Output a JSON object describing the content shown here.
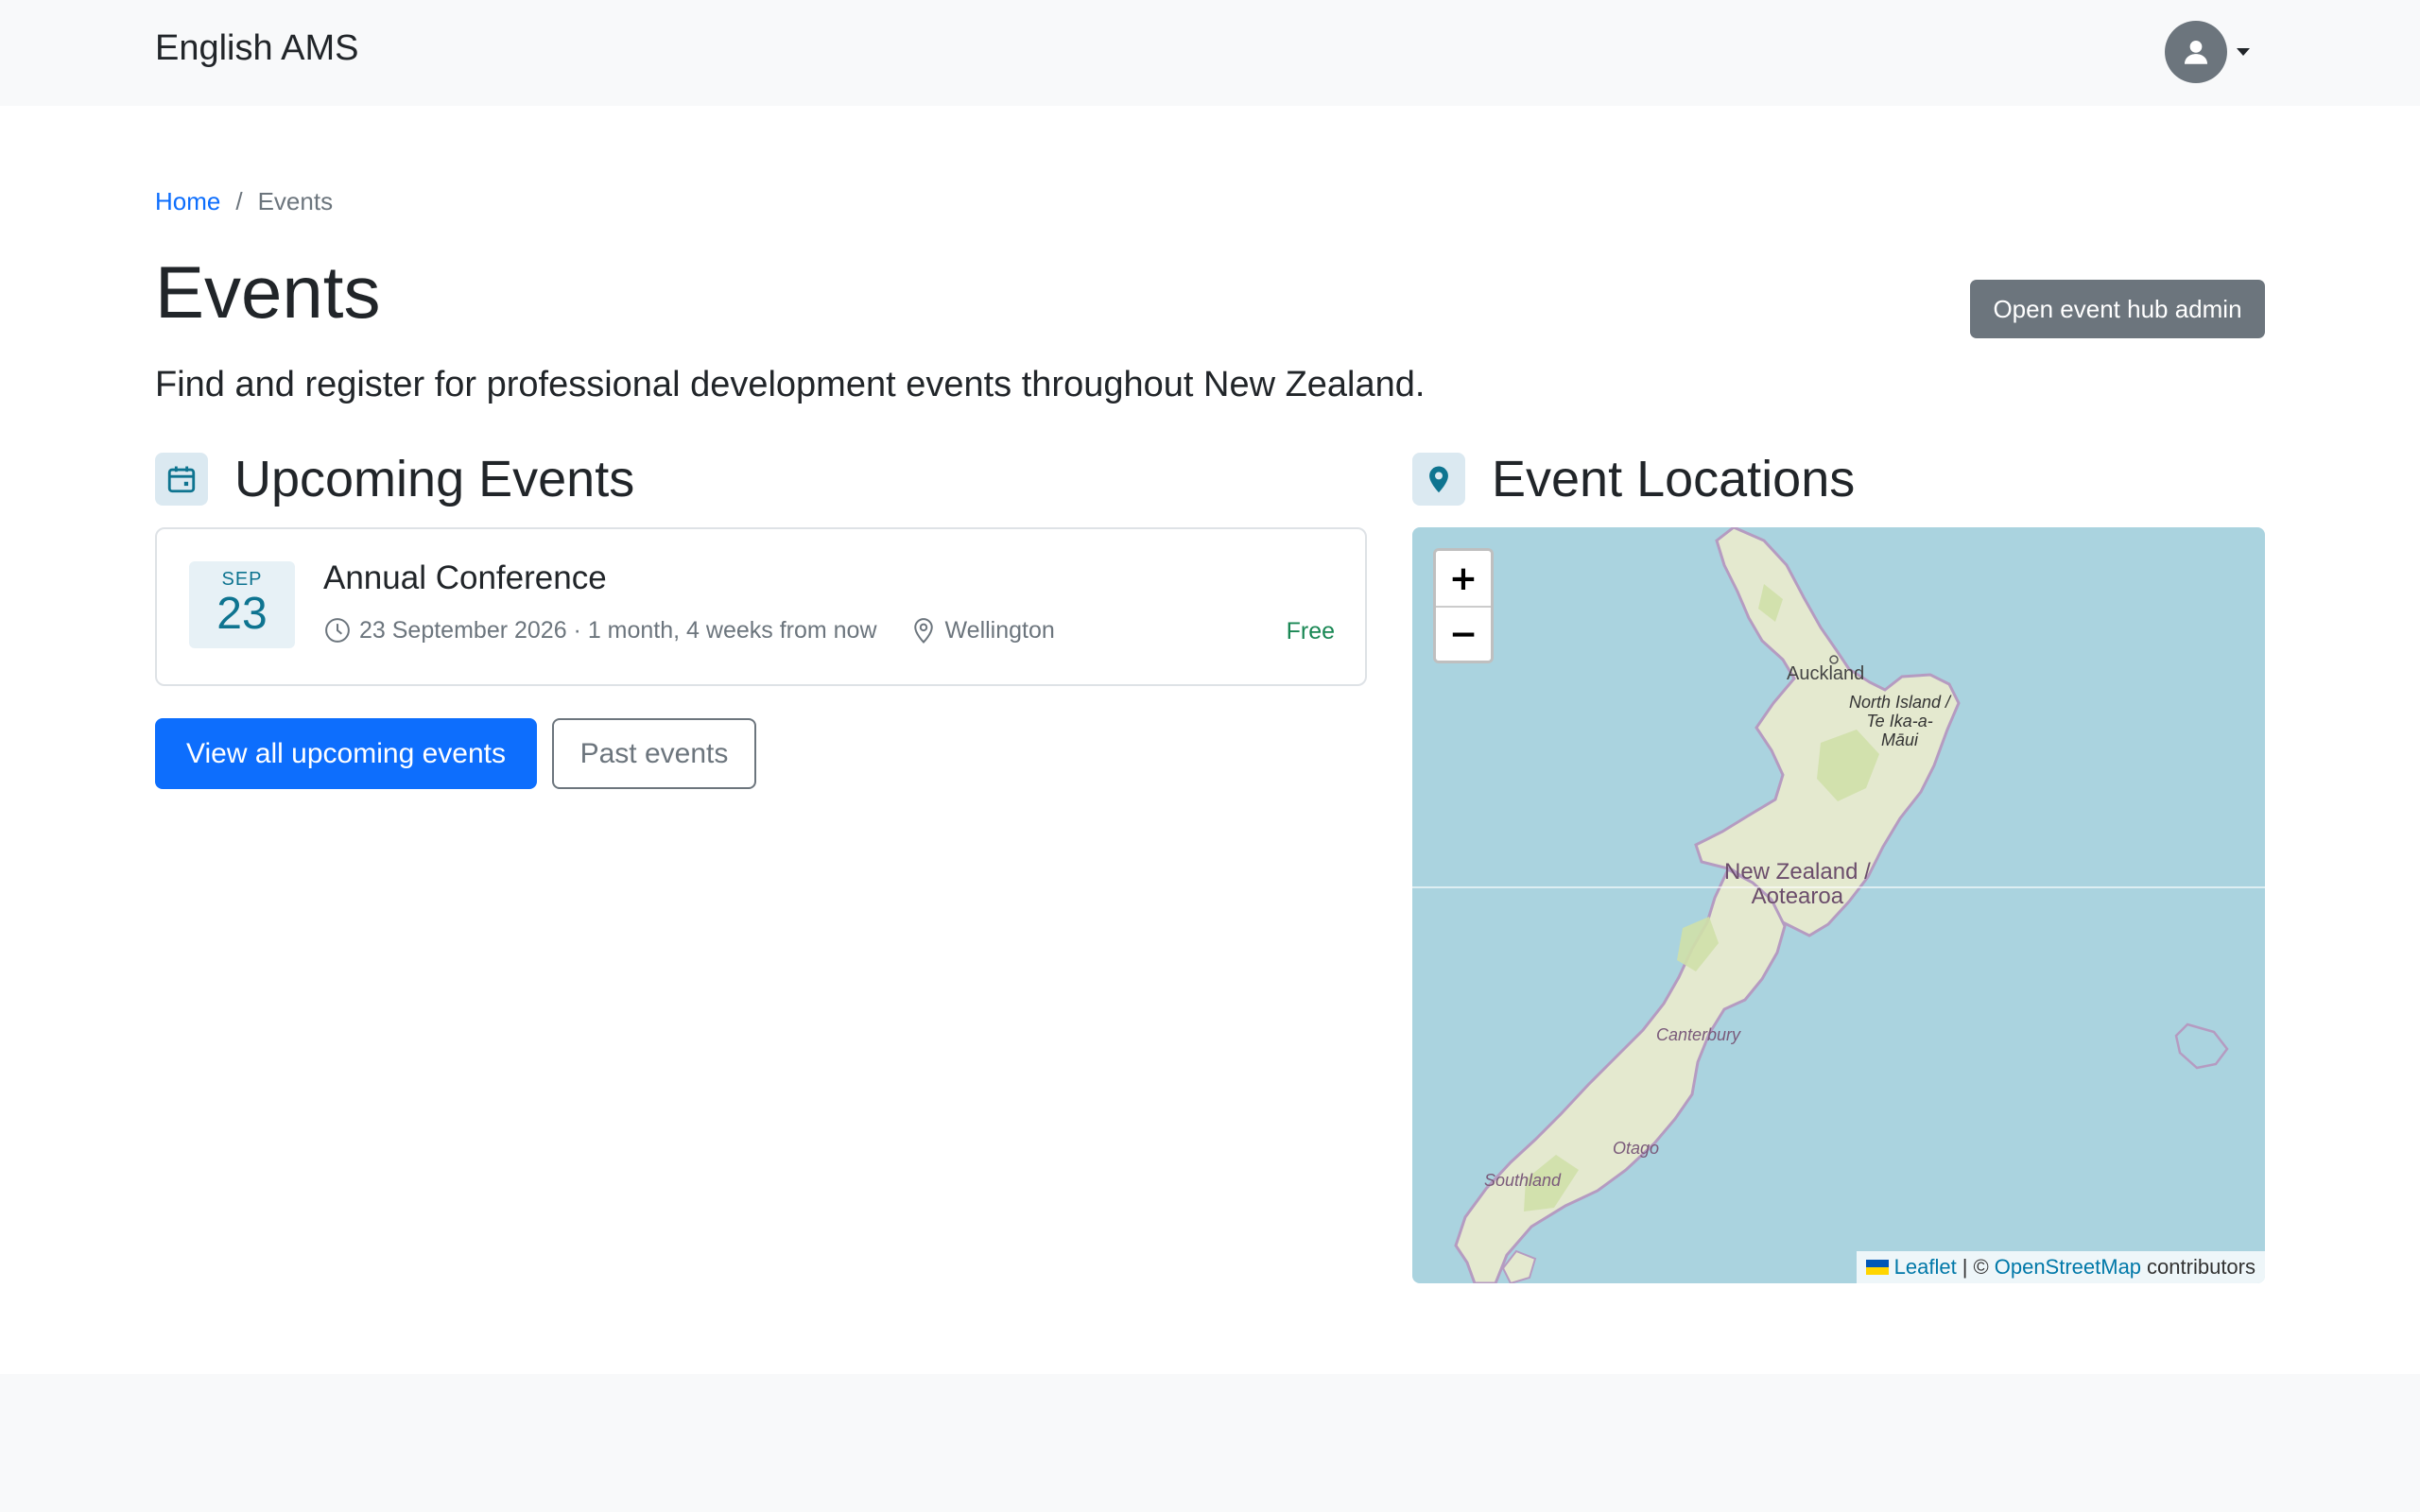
{
  "nav": {
    "brand": "English AMS"
  },
  "breadcrumb": {
    "home": "Home",
    "current": "Events"
  },
  "header": {
    "title": "Events",
    "admin_button": "Open event hub admin",
    "lead": "Find and register for professional development events throughout New Zealand."
  },
  "upcoming": {
    "title": "Upcoming Events",
    "events": [
      {
        "month": "SEP",
        "day": "23",
        "title": "Annual Conference",
        "when": "23 September 2026 · 1 month, 4 weeks from now",
        "location": "Wellington",
        "price": "Free"
      }
    ],
    "view_all_label": "View all upcoming events",
    "past_label": "Past events"
  },
  "locations": {
    "title": "Event Locations",
    "map": {
      "zoom_in": "+",
      "zoom_out": "−",
      "labels": {
        "auckland": "Auckland",
        "north_island": "North Island /\nTe Ika-a-\nMāui",
        "country": "New Zealand /\nAotearoa",
        "canterbury": "Canterbury",
        "otago": "Otago",
        "southland": "Southland"
      },
      "attribution": {
        "leaflet": "Leaflet",
        "sep": "| ©",
        "osm": "OpenStreetMap",
        "contributors": "contributors"
      }
    }
  },
  "colors": {
    "primary": "#0d6efd",
    "secondary": "#6c757d",
    "success": "#198754",
    "accent": "#0e7490",
    "water": "#aad3df",
    "land": "#e6ead2"
  }
}
